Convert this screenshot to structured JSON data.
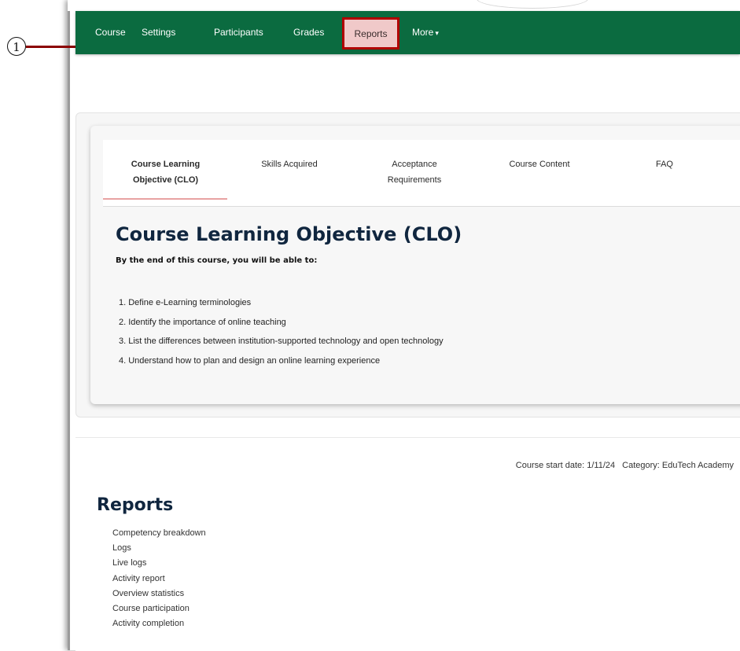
{
  "callout": {
    "number": "1"
  },
  "nav": {
    "items": [
      {
        "label": "Course"
      },
      {
        "label": "Settings"
      },
      {
        "label": "Participants"
      },
      {
        "label": "Grades"
      },
      {
        "label": "Reports"
      },
      {
        "label": "More"
      }
    ],
    "active": "Reports",
    "colors": {
      "bar": "#0b6b40",
      "highlight": "#f0c9c9",
      "highlight_border": "#b00000"
    }
  },
  "tabs": [
    {
      "label_line1": "Course Learning",
      "label_line2": "Objective (CLO)"
    },
    {
      "label_line1": "Skills Acquired",
      "label_line2": ""
    },
    {
      "label_line1": "Acceptance",
      "label_line2": "Requirements"
    },
    {
      "label_line1": "Course Content",
      "label_line2": ""
    },
    {
      "label_line1": "FAQ",
      "label_line2": ""
    }
  ],
  "clo": {
    "title": "Course Learning Objective (CLO)",
    "intro": "By the end of this course, you will be able to:",
    "items": [
      "1. Define e-Learning terminologies",
      "2. Identify  the importance of online teaching",
      "3. List the differences between institution-supported technology and open technology",
      "4. Understand how to plan and design  an online learning experience"
    ]
  },
  "course_meta": {
    "start_date": "Course start date: 1/11/24",
    "category": "Category: EduTech Academy"
  },
  "reports": {
    "title": "Reports",
    "items": [
      "Competency breakdown",
      "Logs",
      "Live logs",
      "Activity report",
      "Overview statistics",
      "Course participation",
      "Activity completion"
    ]
  }
}
